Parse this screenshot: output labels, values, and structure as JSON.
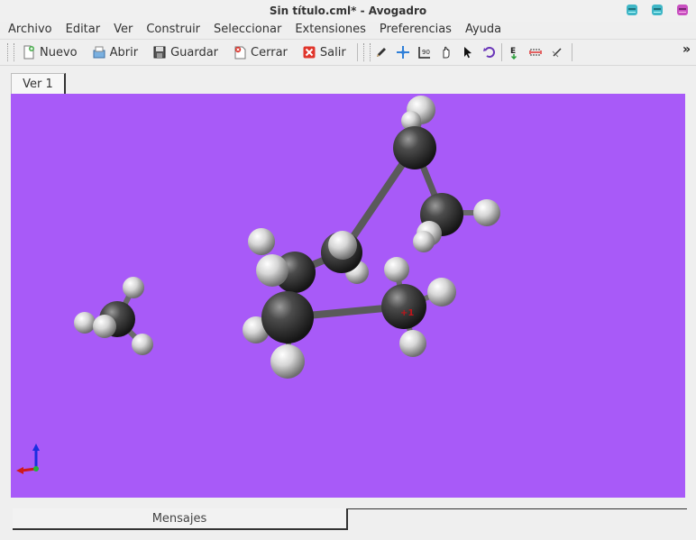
{
  "window": {
    "title": "Sin título.cml* - Avogadro",
    "buttons": [
      {
        "name": "minimize-button",
        "color": "#3fb6c6"
      },
      {
        "name": "maximize-button",
        "color": "#3fb6c6"
      },
      {
        "name": "close-button",
        "color": "#c84fc0"
      }
    ]
  },
  "menu": {
    "items": [
      "Archivo",
      "Editar",
      "Ver",
      "Construir",
      "Seleccionar",
      "Extensiones",
      "Preferencias",
      "Ayuda"
    ]
  },
  "toolbar": {
    "nuevo_label": "Nuevo",
    "abrir_label": "Abrir",
    "guardar_label": "Guardar",
    "cerrar_label": "Cerrar",
    "salir_label": "Salir",
    "overflow": "»",
    "tools": [
      "draw-tool-icon",
      "navigate-tool-icon",
      "measure-tool-icon",
      "manipulate-tool-icon",
      "select-tool-icon",
      "rotate-tool-icon",
      "autoopt-tool-icon",
      "align-tool-icon",
      "bond-centric-tool-icon"
    ]
  },
  "tabs": {
    "view1": "Ver 1"
  },
  "viewport": {
    "background": "#a85af8",
    "atom_label": "+1"
  },
  "bottom": {
    "messages_tab": "Mensajes"
  }
}
